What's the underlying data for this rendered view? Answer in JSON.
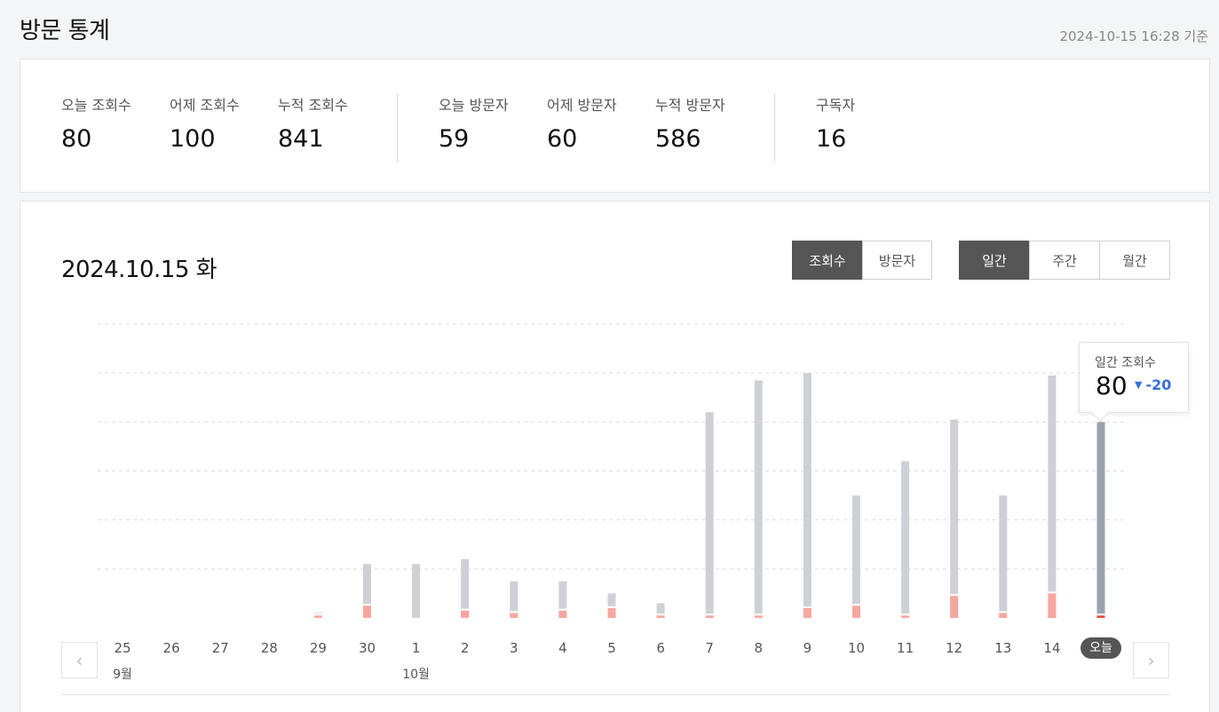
{
  "header": {
    "title": "방문 통계",
    "timestamp": "2024-10-15 16:28 기준"
  },
  "summary": {
    "stats": [
      {
        "label": "오늘 조회수",
        "value": "80"
      },
      {
        "label": "어제 조회수",
        "value": "100"
      },
      {
        "label": "누적 조회수",
        "value": "841"
      },
      {
        "label": "오늘 방문자",
        "value": "59"
      },
      {
        "label": "어제 방문자",
        "value": "60"
      },
      {
        "label": "누적 방문자",
        "value": "586"
      },
      {
        "label": "구독자",
        "value": "16"
      }
    ]
  },
  "chart_panel": {
    "date": "2024.10.15 화",
    "metric_toggle": [
      {
        "label": "조회수",
        "active": true
      },
      {
        "label": "방문자",
        "active": false
      }
    ],
    "period_toggle": [
      {
        "label": "일간",
        "active": true
      },
      {
        "label": "주간",
        "active": false
      },
      {
        "label": "월간",
        "active": false
      }
    ],
    "tooltip": {
      "label": "일간 조회수",
      "value": "80",
      "delta": "-20"
    },
    "months": [
      {
        "label": "9월",
        "index": 0
      },
      {
        "label": "10월",
        "index": 6
      }
    ]
  },
  "chart_data": {
    "type": "bar",
    "categories": [
      "25",
      "26",
      "27",
      "28",
      "29",
      "30",
      "1",
      "2",
      "3",
      "4",
      "5",
      "6",
      "7",
      "8",
      "9",
      "10",
      "11",
      "12",
      "13",
      "14",
      "오늘"
    ],
    "ylim": [
      0,
      120
    ],
    "grid": true,
    "series": [
      {
        "values": [
          0,
          0,
          0,
          0,
          2,
          22,
          22,
          24,
          15,
          15,
          10,
          6,
          84,
          97,
          100,
          50,
          64,
          81,
          50,
          99,
          80
        ]
      },
      {
        "values": [
          0,
          0,
          0,
          0,
          1,
          5,
          0,
          3,
          2,
          3,
          4,
          1,
          1,
          1,
          4,
          5,
          1,
          9,
          2,
          10,
          1
        ]
      }
    ],
    "colors": {
      "total": "#cdd1d6",
      "today_total": "#9aa3ad",
      "sub": "#f7a69f",
      "sub_today": "#e74c3c",
      "accent_teal": "#5fd3c4"
    }
  }
}
